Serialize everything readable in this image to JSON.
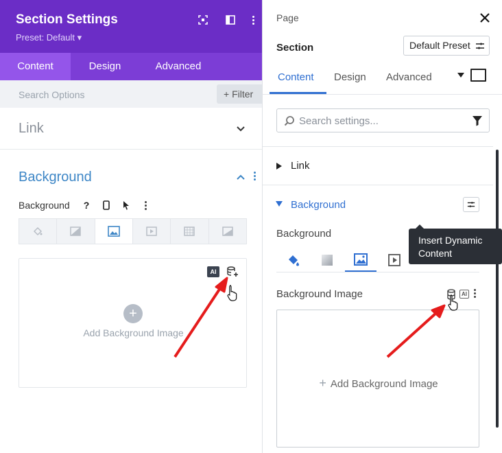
{
  "left_panel": {
    "title": "Section Settings",
    "preset": "Preset: Default ▾",
    "tabs": [
      {
        "label": "Content",
        "active": true
      },
      {
        "label": "Design",
        "active": false
      },
      {
        "label": "Advanced",
        "active": false
      }
    ],
    "search_placeholder": "Search Options",
    "filter_label": "+ Filter",
    "link_group": "Link",
    "background_group": "Background",
    "background_label": "Background",
    "help_glyph": "?",
    "drop_zone": {
      "ai_badge": "AI",
      "plus": "+",
      "add_label": "Add Background Image"
    }
  },
  "right_panel": {
    "breadcrumb": "Page",
    "element_name": "Section",
    "preset_button": "Default Preset",
    "tabs": [
      {
        "label": "Content",
        "active": true
      },
      {
        "label": "Design",
        "active": false
      },
      {
        "label": "Advanced",
        "active": false
      }
    ],
    "search_placeholder": "Search settings...",
    "link_group": "Link",
    "background_group": "Background",
    "background_label": "Background",
    "background_image_label": "Background Image",
    "ai_badge": "AI",
    "add_label": "Add Background Image",
    "add_plus": "+"
  },
  "tooltip": {
    "line1": "Insert Dynamic",
    "line2": "Content"
  },
  "colors": {
    "left_header": "#6b2dc6",
    "left_tab_active": "#9455ea",
    "accent_blue": "#2f6fd1",
    "annotation_red": "#e51c1c",
    "tooltip_bg": "#2b2f36"
  }
}
